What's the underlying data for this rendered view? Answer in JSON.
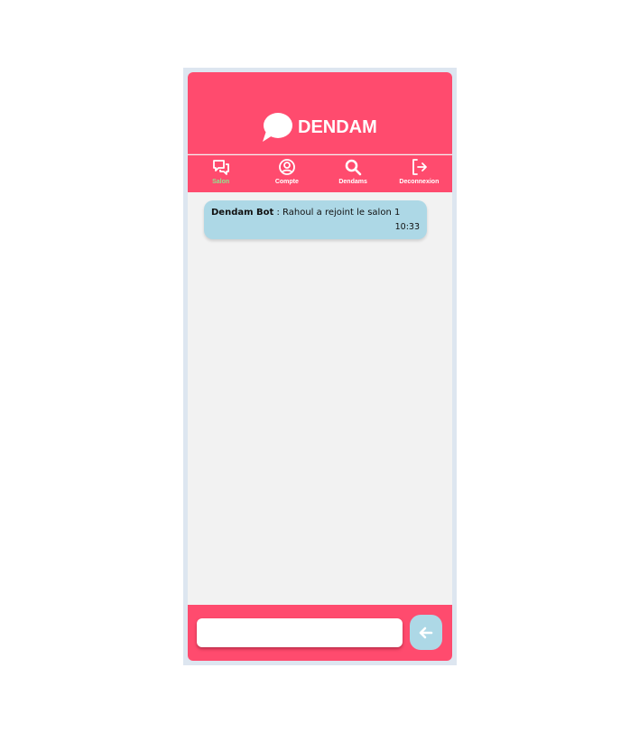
{
  "brand": {
    "name": "DENDAM",
    "logo_icon": "speech-bubble-icon"
  },
  "nav": [
    {
      "label": "Salon",
      "icon": "chat-icon",
      "active": true
    },
    {
      "label": "Compte",
      "icon": "user-circle-icon"
    },
    {
      "label": "Dendams",
      "icon": "search-icon"
    },
    {
      "label": "Deconnexion",
      "icon": "logout-icon"
    }
  ],
  "messages": [
    {
      "author": "Dendam Bot",
      "separator": " : ",
      "text": "Rahoul a rejoint le salon 1",
      "time": "10:33"
    }
  ],
  "composer": {
    "value": "",
    "send_icon": "arrow-left-icon"
  },
  "colors": {
    "primary": "#ff4b6e",
    "bubble": "#add8e6",
    "active_nav": "#8ee68e",
    "background": "#f2f2f2"
  }
}
